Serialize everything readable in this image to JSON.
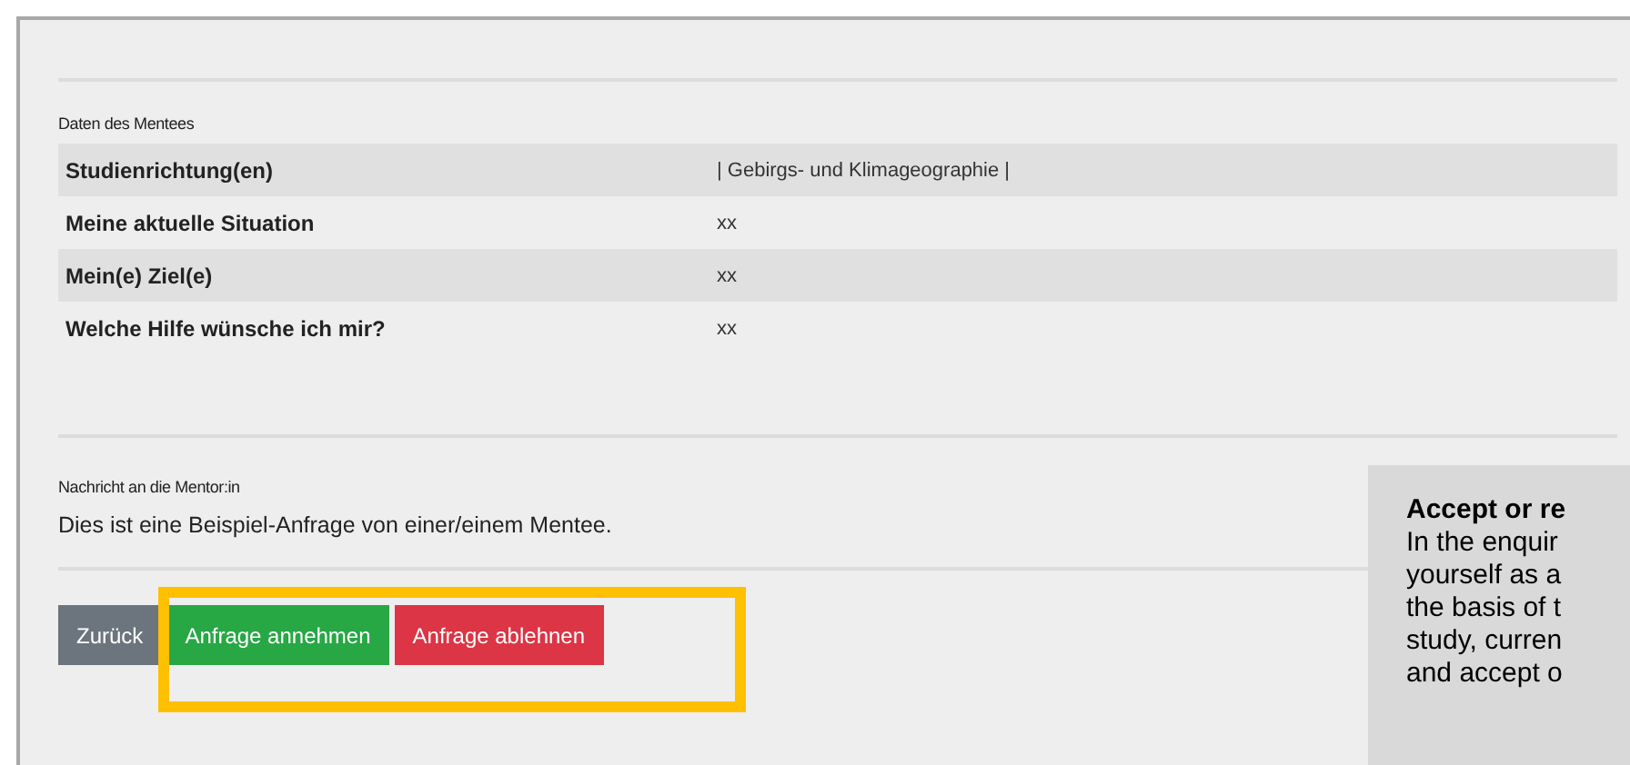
{
  "mentee_section": {
    "heading": "Daten des Mentees",
    "rows": [
      {
        "label": "Studienrichtung(en)",
        "value": "| Gebirgs- und Klimageographie |"
      },
      {
        "label": "Meine aktuelle Situation",
        "value": "xx"
      },
      {
        "label": "Mein(e) Ziel(e)",
        "value": "xx"
      },
      {
        "label": "Welche Hilfe wünsche ich mir?",
        "value": "xx"
      }
    ]
  },
  "message_section": {
    "heading": "Nachricht an die Mentor:in",
    "text": "Dies ist eine Beispiel-Anfrage von einer/einem Mentee."
  },
  "buttons": [
    {
      "label": "Zurück",
      "kind": "back"
    },
    {
      "label": "Anfrage annehmen",
      "kind": "accept"
    },
    {
      "label": "Anfrage ablehnen",
      "kind": "reject"
    }
  ],
  "callout": {
    "title": "Accept or re",
    "lines": [
      "In the enquir",
      "yourself as a",
      "the basis of t",
      "study, curren",
      "and accept o"
    ]
  }
}
